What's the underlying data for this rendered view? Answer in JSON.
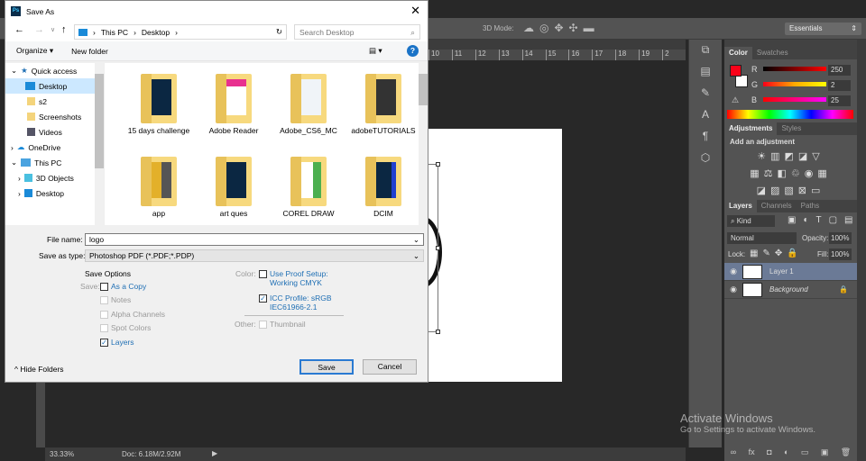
{
  "dialog": {
    "title": "Save As",
    "breadcrumb": [
      "This PC",
      "Desktop"
    ],
    "search_placeholder": "Search Desktop",
    "organize": "Organize",
    "new_folder": "New folder",
    "nav": [
      {
        "label": "Quick access"
      },
      {
        "label": "Desktop"
      },
      {
        "label": "s2"
      },
      {
        "label": "Screenshots"
      },
      {
        "label": "Videos"
      },
      {
        "label": "OneDrive"
      },
      {
        "label": "This PC"
      },
      {
        "label": "3D Objects"
      },
      {
        "label": "Desktop"
      }
    ],
    "files": [
      {
        "name": "15 days challenge"
      },
      {
        "name": "Adobe Reader"
      },
      {
        "name": "Adobe_CS6_MC"
      },
      {
        "name": "adobeTUTORIALS"
      },
      {
        "name": "app"
      },
      {
        "name": "art ques"
      },
      {
        "name": "COREL DRAW"
      },
      {
        "name": "DCIM"
      }
    ],
    "file_name_label": "File name:",
    "file_name": "logo",
    "type_label": "Save as type:",
    "type": "Photoshop PDF (*.PDF;*.PDP)",
    "save_options": "Save Options",
    "save_label": "Save:",
    "as_copy": "As a Copy",
    "notes": "Notes",
    "alpha": "Alpha Channels",
    "spot": "Spot Colors",
    "layers": "Layers",
    "color_label": "Color:",
    "proof1": "Use Proof Setup:",
    "proof2": "Working CMYK",
    "icc1": "ICC Profile:  sRGB",
    "icc2": "IEC61966-2.1",
    "other_label": "Other:",
    "thumbnail": "Thumbnail",
    "hide_folders": "Hide Folders",
    "save": "Save",
    "cancel": "Cancel"
  },
  "options_bar": {
    "mode_3d": "3D Mode:",
    "workspace": "Essentials"
  },
  "ruler": [
    "10",
    "11",
    "12",
    "13",
    "14",
    "15",
    "16",
    "17",
    "18",
    "19",
    "2"
  ],
  "color_panel": {
    "tabs": [
      "Color",
      "Swatches"
    ],
    "r": "250",
    "g": "2",
    "b": "25",
    "fg": "#fa0219",
    "rl": "R",
    "gl": "G",
    "bl": "B"
  },
  "adjustments": {
    "tabs": [
      "Adjustments",
      "Styles"
    ],
    "heading": "Add an adjustment"
  },
  "layers_panel": {
    "tabs": [
      "Layers",
      "Channels",
      "Paths"
    ],
    "kind": "Kind",
    "blend": "Normal",
    "opacity_label": "Opacity:",
    "opacity": "100%",
    "lock_label": "Lock:",
    "fill_label": "Fill:",
    "fill": "100%",
    "layers": [
      {
        "name": "Layer 1"
      },
      {
        "name": "Background"
      }
    ]
  },
  "status": {
    "zoom": "33.33%",
    "doc": "Doc: 6.18M/2.92M"
  },
  "watermark": {
    "line1": "Activate Windows",
    "line2": "Go to Settings to activate Windows."
  }
}
